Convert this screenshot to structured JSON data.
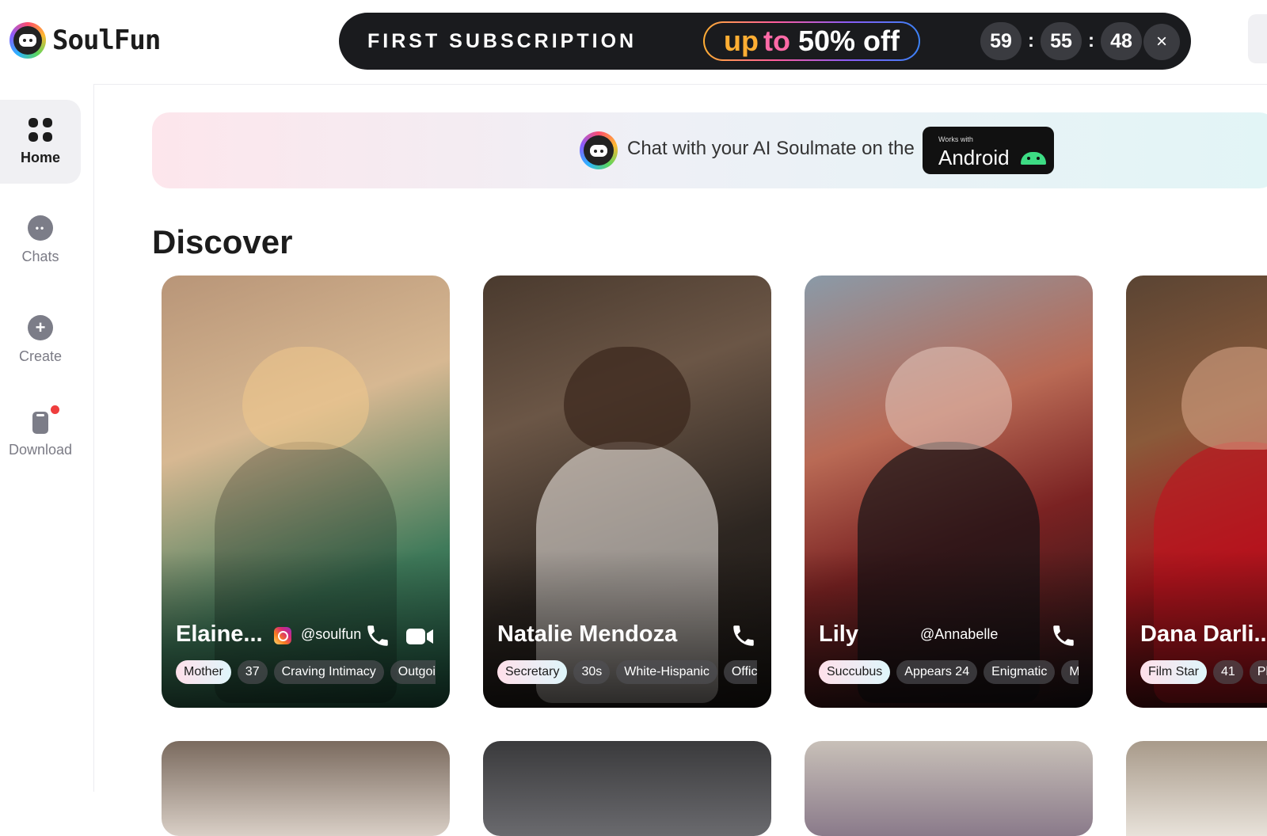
{
  "brand": {
    "name": "SoulFun"
  },
  "promo": {
    "title": "FIRST SUBSCRIPTION",
    "pill_up": "up",
    "pill_to": "to",
    "pill_off": "50% off",
    "countdown": {
      "hours": "59",
      "minutes": "55",
      "seconds": "48",
      "sep": ":"
    },
    "close": "×"
  },
  "sidebar": {
    "items": [
      {
        "label": "Home",
        "icon": "home-grid-icon",
        "active": true
      },
      {
        "label": "Chats",
        "icon": "chat-bubble-icon"
      },
      {
        "label": "Create",
        "icon": "plus-circle-icon"
      },
      {
        "label": "Download",
        "icon": "phone-icon",
        "badge": "notification-dot"
      }
    ]
  },
  "app_banner": {
    "text": "Chat with your AI Soulmate on the",
    "badge_small": "Works with",
    "badge_big": "Android"
  },
  "section": {
    "title": "Discover"
  },
  "cards": [
    {
      "name": "Elaine...",
      "handle": "@soulfun",
      "tags": [
        "Mother",
        "37",
        "Craving Intimacy",
        "Outgoir"
      ]
    },
    {
      "name": "Natalie Mendoza",
      "tags": [
        "Secretary",
        "30s",
        "White-Hispanic",
        "Office"
      ]
    },
    {
      "name": "Lily",
      "handle": "@Annabelle",
      "tags": [
        "Succubus",
        "Appears 24",
        "Enigmatic",
        "Ma"
      ]
    },
    {
      "name": "Dana Darli...",
      "tags": [
        "Film Star",
        "41",
        "Pla"
      ]
    }
  ],
  "colors": {
    "accent_gradient_start": "#ffae33",
    "accent_gradient_end": "#3b82f6",
    "promo_bg": "#1a1b1e",
    "notification": "#ef3d3d"
  }
}
